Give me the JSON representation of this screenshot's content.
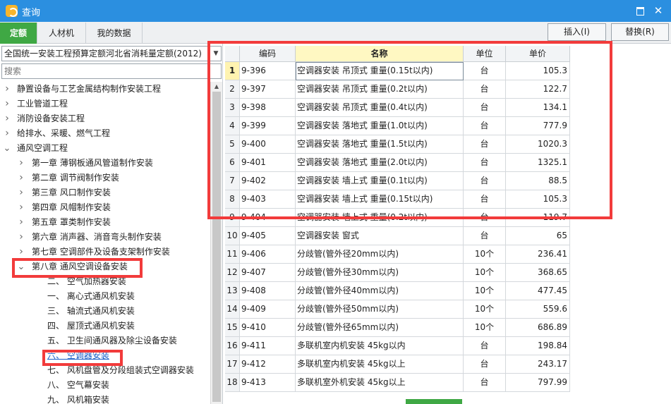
{
  "window": {
    "title": "查询"
  },
  "tabs": [
    {
      "label": "定额",
      "active": true
    },
    {
      "label": "人材机",
      "active": false
    },
    {
      "label": "我的数据",
      "active": false
    }
  ],
  "toolbar": {
    "insert_label": "插入(I)",
    "replace_label": "替换(R)"
  },
  "library_select": {
    "value": "全国统一安装工程预算定额河北省消耗量定额(2012)"
  },
  "search": {
    "placeholder": "搜索"
  },
  "tree": [
    {
      "label": "静置设备与工艺金属结构制作安装工程",
      "level": 0,
      "state": "collapsed"
    },
    {
      "label": "工业管道工程",
      "level": 0,
      "state": "collapsed"
    },
    {
      "label": "消防设备安装工程",
      "level": 0,
      "state": "collapsed"
    },
    {
      "label": "给排水、采暖、燃气工程",
      "level": 0,
      "state": "collapsed"
    },
    {
      "label": "通风空调工程",
      "level": 0,
      "state": "expanded"
    },
    {
      "label": "第一章  薄钢板通风管道制作安装",
      "level": 1,
      "state": "collapsed"
    },
    {
      "label": "第二章  调节阀制作安装",
      "level": 1,
      "state": "collapsed"
    },
    {
      "label": "第三章  风口制作安装",
      "level": 1,
      "state": "collapsed"
    },
    {
      "label": "第四章  风帽制作安装",
      "level": 1,
      "state": "collapsed"
    },
    {
      "label": "第五章  罩类制作安装",
      "level": 1,
      "state": "collapsed"
    },
    {
      "label": "第六章  消声器、消音弯头制作安装",
      "level": 1,
      "state": "collapsed"
    },
    {
      "label": "第七章  空调部件及设备支架制作安装",
      "level": 1,
      "state": "collapsed"
    },
    {
      "label": "第八章  通风空调设备安装",
      "level": 1,
      "state": "expanded"
    },
    {
      "label": "二、  空气加热器安装",
      "level": 2,
      "state": "leaf"
    },
    {
      "label": "一、  离心式通风机安装",
      "level": 2,
      "state": "leaf"
    },
    {
      "label": "三、  轴流式通风机安装",
      "level": 2,
      "state": "leaf"
    },
    {
      "label": "四、  屋顶式通风机安装",
      "level": 2,
      "state": "leaf"
    },
    {
      "label": "五、  卫生间通风器及除尘设备安装",
      "level": 2,
      "state": "leaf"
    },
    {
      "label": "六、  空调器安装",
      "level": 2,
      "state": "selected"
    },
    {
      "label": "七、  风机盘管及分段组装式空调器安装",
      "level": 2,
      "state": "leaf"
    },
    {
      "label": "八、  空气幕安装",
      "level": 2,
      "state": "leaf"
    },
    {
      "label": "九、  风机箱安装",
      "level": 2,
      "state": "leaf"
    }
  ],
  "grid": {
    "columns": [
      "编码",
      "名称",
      "单位",
      "单价"
    ],
    "rows": [
      {
        "no": "1",
        "code": "9-396",
        "name": "空调器安装 吊顶式 重量(0.15t以内)",
        "unit": "台",
        "price": "105.3"
      },
      {
        "no": "2",
        "code": "9-397",
        "name": "空调器安装 吊顶式 重量(0.2t以内)",
        "unit": "台",
        "price": "122.7"
      },
      {
        "no": "3",
        "code": "9-398",
        "name": "空调器安装 吊顶式 重量(0.4t以内)",
        "unit": "台",
        "price": "134.1"
      },
      {
        "no": "4",
        "code": "9-399",
        "name": "空调器安装 落地式 重量(1.0t以内)",
        "unit": "台",
        "price": "777.9"
      },
      {
        "no": "5",
        "code": "9-400",
        "name": "空调器安装 落地式 重量(1.5t以内)",
        "unit": "台",
        "price": "1020.3"
      },
      {
        "no": "6",
        "code": "9-401",
        "name": "空调器安装 落地式 重量(2.0t以内)",
        "unit": "台",
        "price": "1325.1"
      },
      {
        "no": "7",
        "code": "9-402",
        "name": "空调器安装 墙上式 重量(0.1t以内)",
        "unit": "台",
        "price": "88.5"
      },
      {
        "no": "8",
        "code": "9-403",
        "name": "空调器安装 墙上式 重量(0.15t以内)",
        "unit": "台",
        "price": "105.3"
      },
      {
        "no": "9",
        "code": "9-404",
        "name": "空调器安装 墙上式 重量(0.2t以内)",
        "unit": "台",
        "price": "119.7"
      },
      {
        "no": "10",
        "code": "9-405",
        "name": "空调器安装 窗式",
        "unit": "台",
        "price": "65"
      },
      {
        "no": "11",
        "code": "9-406",
        "name": "分歧管(管外径20mm以内)",
        "unit": "10个",
        "price": "236.41"
      },
      {
        "no": "12",
        "code": "9-407",
        "name": "分歧管(管外径30mm以内)",
        "unit": "10个",
        "price": "368.65"
      },
      {
        "no": "13",
        "code": "9-408",
        "name": "分歧管(管外径40mm以内)",
        "unit": "10个",
        "price": "477.45"
      },
      {
        "no": "14",
        "code": "9-409",
        "name": "分歧管(管外径50mm以内)",
        "unit": "10个",
        "price": "559.6"
      },
      {
        "no": "15",
        "code": "9-410",
        "name": "分歧管(管外径65mm以内)",
        "unit": "10个",
        "price": "686.89"
      },
      {
        "no": "16",
        "code": "9-411",
        "name": "多联机室内机安装 45kg以内",
        "unit": "台",
        "price": "198.84"
      },
      {
        "no": "17",
        "code": "9-412",
        "name": "多联机室内机安装 45kg以上",
        "unit": "台",
        "price": "243.17"
      },
      {
        "no": "18",
        "code": "9-413",
        "name": "多联机室外机安装 45kg以上",
        "unit": "台",
        "price": "797.99"
      }
    ]
  },
  "colors": {
    "title_bar": "#2b8fe0",
    "active_tab": "#3fa844",
    "highlight": "#f23b3b",
    "name_header": "#fff8c2"
  },
  "icons": {
    "app": "app-logo-icon",
    "minimize": "minimize-icon",
    "close": "close-icon"
  }
}
